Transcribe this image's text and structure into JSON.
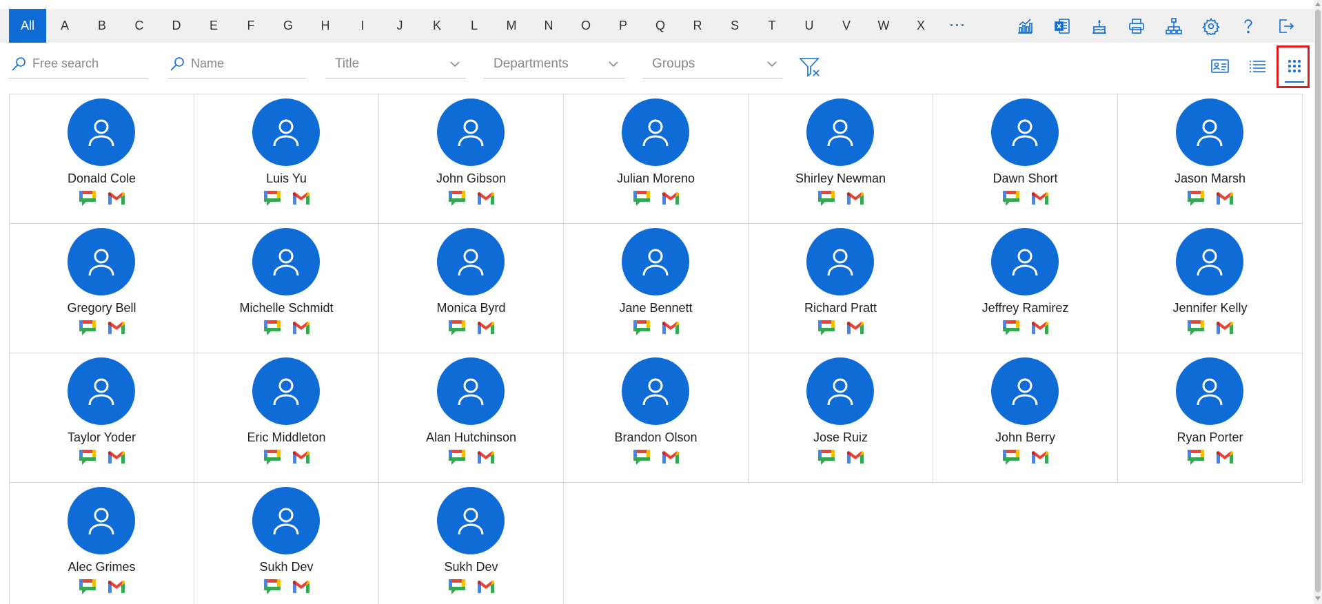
{
  "alphabet": {
    "items": [
      "All",
      "A",
      "B",
      "C",
      "D",
      "E",
      "F",
      "G",
      "H",
      "I",
      "J",
      "K",
      "L",
      "M",
      "N",
      "O",
      "P",
      "Q",
      "R",
      "S",
      "T",
      "U",
      "V",
      "W",
      "X"
    ],
    "active": "All",
    "more": "···"
  },
  "toolbar": {
    "tools": [
      "analytics-icon",
      "excel-export-icon",
      "cake-icon",
      "print-icon",
      "org-chart-icon",
      "settings-gear-icon",
      "help-icon",
      "sign-out-icon"
    ]
  },
  "filters": {
    "free_search_placeholder": "Free search",
    "name_placeholder": "Name",
    "title_label": "Title",
    "departments_label": "Departments",
    "groups_label": "Groups"
  },
  "views": [
    "contact-card-view-icon",
    "list-view-icon",
    "grid-view-icon"
  ],
  "active_view": "grid-view-icon",
  "colors": {
    "accent": "#0f6cd6",
    "highlight": "#e01b1b"
  },
  "people": [
    {
      "name": "Donald Cole"
    },
    {
      "name": "Luis Yu"
    },
    {
      "name": "John Gibson"
    },
    {
      "name": "Julian Moreno"
    },
    {
      "name": "Shirley Newman"
    },
    {
      "name": "Dawn Short"
    },
    {
      "name": "Jason Marsh"
    },
    {
      "name": "Gregory Bell"
    },
    {
      "name": "Michelle Schmidt"
    },
    {
      "name": "Monica Byrd"
    },
    {
      "name": "Jane Bennett"
    },
    {
      "name": "Richard Pratt"
    },
    {
      "name": "Jeffrey Ramirez"
    },
    {
      "name": "Jennifer Kelly"
    },
    {
      "name": "Taylor Yoder"
    },
    {
      "name": "Eric Middleton"
    },
    {
      "name": "Alan Hutchinson"
    },
    {
      "name": "Brandon Olson"
    },
    {
      "name": "Jose Ruiz"
    },
    {
      "name": "John Berry"
    },
    {
      "name": "Ryan Porter"
    },
    {
      "name": "Alec Grimes"
    },
    {
      "name": "Sukh Dev"
    },
    {
      "name": "Sukh Dev"
    }
  ]
}
